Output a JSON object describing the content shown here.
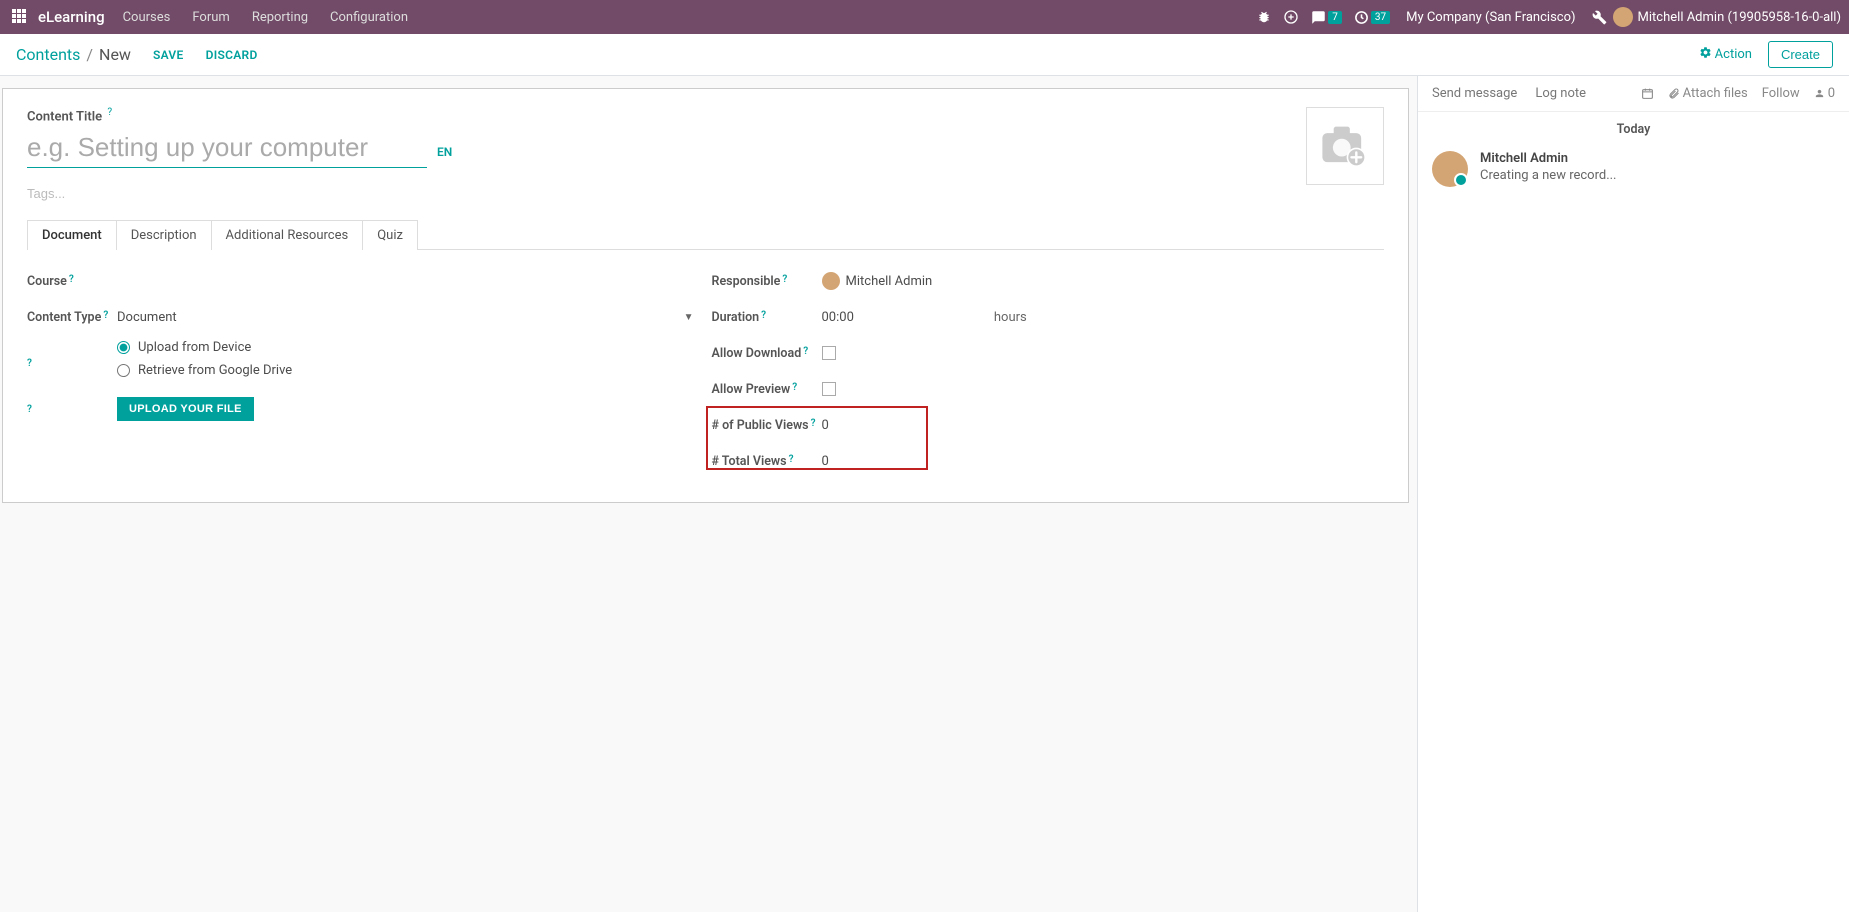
{
  "topbar": {
    "brand": "eLearning",
    "nav": [
      "Courses",
      "Forum",
      "Reporting",
      "Configuration"
    ],
    "chat_badge": "7",
    "clock_badge": "37",
    "company": "My Company (San Francisco)",
    "user": "Mitchell Admin (19905958-16-0-all)"
  },
  "controlbar": {
    "breadcrumb_root": "Contents",
    "breadcrumb_cur": "New",
    "save": "SAVE",
    "discard": "DISCARD",
    "action": "Action",
    "create": "Create"
  },
  "form": {
    "title_label": "Content Title",
    "title_placeholder": "e.g. Setting up your computer",
    "lang": "EN",
    "tags_placeholder": "Tags...",
    "tabs": [
      "Document",
      "Description",
      "Additional Resources",
      "Quiz"
    ],
    "left": {
      "course_label": "Course",
      "content_type_label": "Content Type",
      "content_type_value": "Document",
      "radio_upload": "Upload from Device",
      "radio_drive": "Retrieve from Google Drive",
      "upload_btn": "UPLOAD YOUR FILE"
    },
    "right": {
      "responsible_label": "Responsible",
      "responsible_value": "Mitchell Admin",
      "duration_label": "Duration",
      "duration_value": "00:00",
      "duration_unit": "hours",
      "allow_download_label": "Allow Download",
      "allow_preview_label": "Allow Preview",
      "public_views_label": "# of Public Views",
      "public_views_value": "0",
      "total_views_label": "# Total Views",
      "total_views_value": "0"
    }
  },
  "chatter": {
    "send": "Send message",
    "log": "Log note",
    "attach": "Attach files",
    "follow": "Follow",
    "followers": "0",
    "date": "Today",
    "msg_author": "Mitchell Admin",
    "msg_text": "Creating a new record..."
  }
}
